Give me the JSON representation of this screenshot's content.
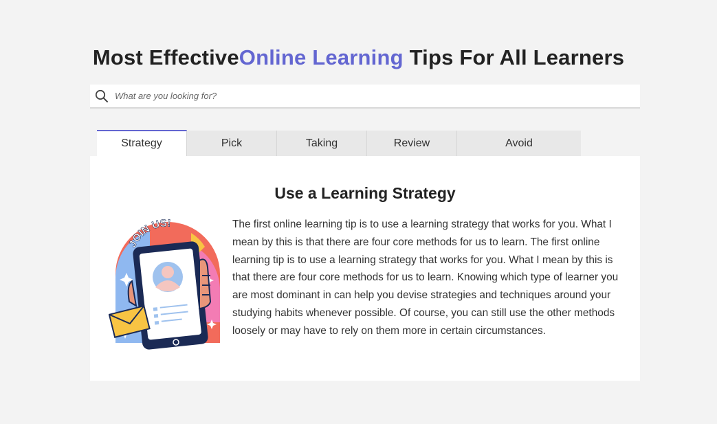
{
  "header": {
    "title_prefix": "Most Effective",
    "title_accent": "Online Learning",
    "title_suffix": " Tips For All Learners"
  },
  "search": {
    "placeholder": "What are you looking for?"
  },
  "tabs": [
    {
      "label": "Strategy",
      "active": true
    },
    {
      "label": "Pick",
      "active": false
    },
    {
      "label": "Taking",
      "active": false
    },
    {
      "label": "Review",
      "active": false
    },
    {
      "label": "Avoid",
      "active": false
    }
  ],
  "content": {
    "heading": "Use a Learning Strategy",
    "illustration_text": "JOIN US!",
    "body": "The first online learning tip is to use a learning strategy that works for you. What I mean by this is that there are four core methods for us to learn. The first online learning tip is to use a learning strategy that works for you. What I mean by this is that there are four core methods for us to learn. Knowing which type of learner you are most dominant in can help you devise strategies and techniques around your studying habits whenever possible. Of course, you can still use the other methods loosely or may have to rely on them more in certain circumstances."
  },
  "colors": {
    "accent": "#6366d1",
    "background": "#f3f3f3",
    "panel": "#ffffff",
    "tab_inactive": "#e8e8e8"
  },
  "icons": {
    "search": "search-icon",
    "illustration": "join-us-phone-illustration"
  }
}
